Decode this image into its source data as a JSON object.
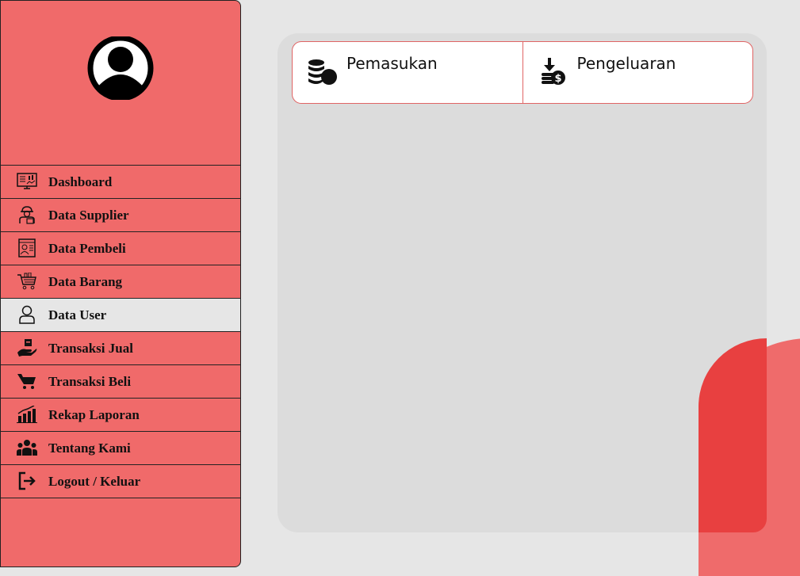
{
  "colors": {
    "background": "#e6e6e6",
    "sidebar": "#f06a6a",
    "accent": "#e84040",
    "panel": "#dcdcdc"
  },
  "sidebar": {
    "avatar_icon": "user-avatar-icon",
    "items": [
      {
        "label": "Dashboard",
        "icon": "monitor-chart-icon",
        "active": false
      },
      {
        "label": "Data Supplier",
        "icon": "worker-icon",
        "active": false
      },
      {
        "label": "Data Pembeli",
        "icon": "id-card-icon",
        "active": false
      },
      {
        "label": "Data Barang",
        "icon": "shopping-cart-items-icon",
        "active": false
      },
      {
        "label": "Data User",
        "icon": "user-outline-icon",
        "active": true
      },
      {
        "label": "Transaksi Jual",
        "icon": "hand-box-icon",
        "active": false
      },
      {
        "label": "Transaksi Beli",
        "icon": "cart-icon",
        "active": false
      },
      {
        "label": "Rekap Laporan",
        "icon": "bar-chart-icon",
        "active": false
      },
      {
        "label": "Tentang Kami",
        "icon": "group-icon",
        "active": false
      },
      {
        "label": "Logout / Keluar",
        "icon": "logout-icon",
        "active": false
      }
    ]
  },
  "main": {
    "tabs": [
      {
        "label": "Pemasukan",
        "icon": "coins-stack-icon"
      },
      {
        "label": "Pengeluaran",
        "icon": "download-coins-icon"
      }
    ]
  }
}
